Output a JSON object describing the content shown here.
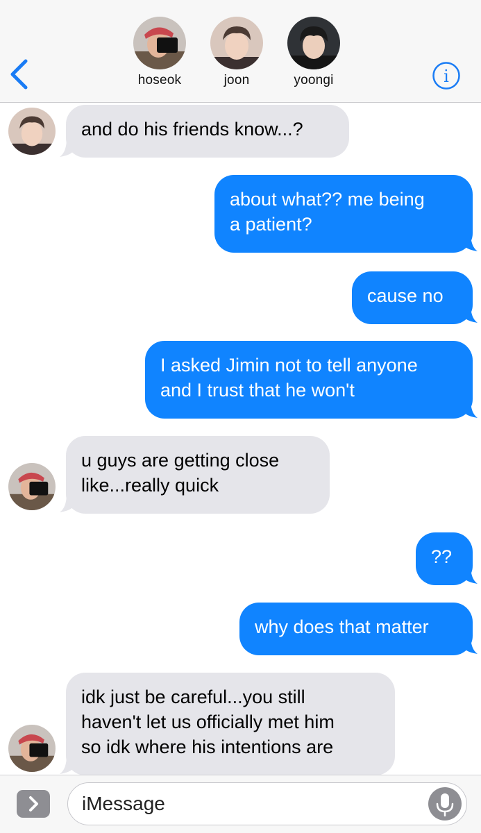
{
  "header": {
    "participants": [
      {
        "name": "hoseok"
      },
      {
        "name": "joon"
      },
      {
        "name": "yoongi"
      }
    ]
  },
  "messages": [
    {
      "direction": "received",
      "sender": "joon",
      "lines": [
        "and do his friends know...?"
      ]
    },
    {
      "direction": "sent",
      "lines": [
        "about what?? me being",
        "a patient?"
      ]
    },
    {
      "direction": "sent",
      "lines": [
        "cause no"
      ]
    },
    {
      "direction": "sent",
      "lines": [
        "I asked Jimin not to tell anyone",
        "and I trust that he won't"
      ]
    },
    {
      "direction": "received",
      "sender": "hoseok",
      "lines": [
        "u guys are getting close",
        "like...really quick"
      ]
    },
    {
      "direction": "sent",
      "lines": [
        "??"
      ]
    },
    {
      "direction": "sent",
      "lines": [
        "why does that matter"
      ]
    },
    {
      "direction": "received",
      "sender": "hoseok",
      "lines": [
        "idk just be careful...you still",
        "haven't let us officially met him",
        "so idk where his intentions are"
      ]
    }
  ],
  "input": {
    "placeholder": "iMessage"
  },
  "colors": {
    "sent_bubble": "#1084ff",
    "received_bubble": "#e5e5ea",
    "accent": "#1a7cf5"
  },
  "icons": {
    "back": "chevron-left-icon",
    "info": "info-icon",
    "apps": "chevron-right-icon",
    "mic": "microphone-icon"
  }
}
